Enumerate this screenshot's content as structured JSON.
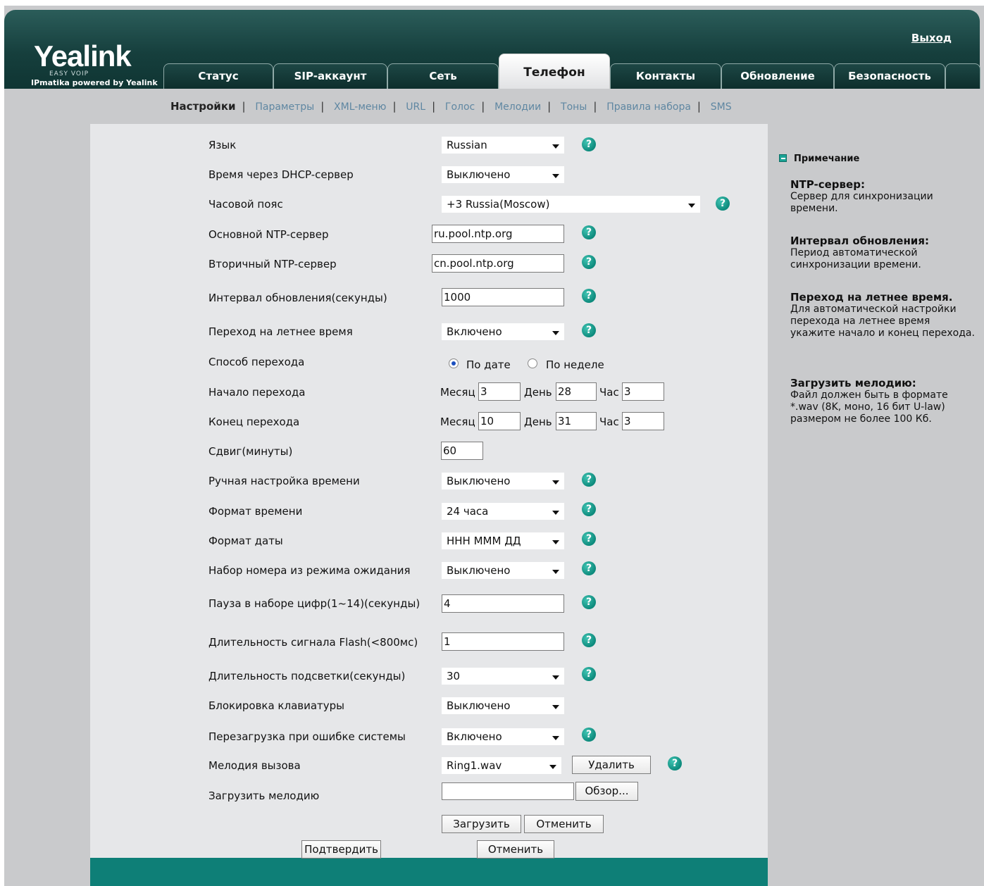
{
  "header": {
    "brand": "Yealink",
    "easy_voip": "EASY VOIP",
    "tagline": "IPmatika powered by Yealink",
    "logout": "Выход"
  },
  "tabs": [
    {
      "label": "Статус"
    },
    {
      "label": "SIP-аккаунт"
    },
    {
      "label": "Сеть"
    },
    {
      "label": "Телефон",
      "active": true
    },
    {
      "label": "Контакты"
    },
    {
      "label": "Обновление"
    },
    {
      "label": "Безопасность"
    }
  ],
  "subnav": [
    {
      "label": "Настройки",
      "active": true
    },
    {
      "label": "Параметры"
    },
    {
      "label": "XML-меню"
    },
    {
      "label": "URL"
    },
    {
      "label": "Голос"
    },
    {
      "label": "Мелодии"
    },
    {
      "label": "Тоны"
    },
    {
      "label": "Правила набора"
    },
    {
      "label": "SMS"
    }
  ],
  "form": {
    "language": {
      "label": "Язык",
      "value": "Russian"
    },
    "dhcp_time": {
      "label": "Время через DHCP-сервер",
      "value": "Выключено"
    },
    "timezone": {
      "label": "Часовой пояс",
      "value": "+3 Russia(Moscow)"
    },
    "ntp_primary": {
      "label": "Основной NTP-сервер",
      "value": "ru.pool.ntp.org"
    },
    "ntp_secondary": {
      "label": "Вторичный NTP-сервер",
      "value": "cn.pool.ntp.org"
    },
    "update_interval": {
      "label": "Интервал обновления(секунды)",
      "value": "1000"
    },
    "dst": {
      "label": "Переход на летнее время",
      "value": "Включено"
    },
    "dst_type": {
      "label": "Способ перехода",
      "option_date": "По дате",
      "option_week": "По неделе",
      "selected": "По дате"
    },
    "dst_start": {
      "label": "Начало перехода",
      "month_label": "Месяц",
      "month": "3",
      "day_label": "День",
      "day": "28",
      "hour_label": "Час",
      "hour": "3"
    },
    "dst_end": {
      "label": "Конец перехода",
      "month_label": "Месяц",
      "month": "10",
      "day_label": "День",
      "day": "31",
      "hour_label": "Час",
      "hour": "3"
    },
    "offset": {
      "label": "Сдвиг(минуты)",
      "value": "60"
    },
    "manual_time": {
      "label": "Ручная настройка времени",
      "value": "Выключено"
    },
    "time_format": {
      "label": "Формат времени",
      "value": "24 часа"
    },
    "date_format": {
      "label": "Формат даты",
      "value": "ННН МММ ДД"
    },
    "predial": {
      "label": "Набор номера из режима ожидания",
      "value": "Выключено"
    },
    "inter_digit": {
      "label": "Пауза в наборе цифр(1~14)(секунды)",
      "value": "4"
    },
    "flash_duration": {
      "label": "Длительность сигнала Flash(<800мс)",
      "value": "1"
    },
    "backlight": {
      "label": "Длительность подсветки(секунды)",
      "value": "30"
    },
    "keypad_lock": {
      "label": "Блокировка клавиатуры",
      "value": "Выключено"
    },
    "reboot_on_error": {
      "label": "Перезагрузка при ошибке системы",
      "value": "Включено"
    },
    "ringtone": {
      "label": "Мелодия вызова",
      "value": "Ring1.wav",
      "delete_label": "Удалить"
    },
    "upload_ring": {
      "label": "Загрузить мелодию",
      "value": "",
      "browse_label": "Обзор..."
    },
    "upload_button": "Загрузить",
    "upload_cancel": "Отменить",
    "confirm": "Подтвердить",
    "cancel": "Отменить"
  },
  "notes": {
    "heading": "Примечание",
    "items": [
      {
        "title": "NTP-сервер:",
        "text": "Сервер для синхронизации времени."
      },
      {
        "title": "Интервал обновления:",
        "text": "Период автоматической синхронизации времени."
      },
      {
        "title": "Переход на летнее время.",
        "text": "Для автоматической настройки перехода на летнее время укажите начало и конец перехода."
      },
      {
        "title": "Загрузить мелодию:",
        "text": "Файл должен быть в формате *.wav (8K, моно, 16 бит U-law) размером не более 100 Кб."
      }
    ]
  },
  "colors": {
    "header_dark": "#163f3d",
    "accent_teal": "#0e7f77",
    "background_gray": "#c9cacc",
    "content_bg": "#e6e7e9",
    "subnav_link": "#5f87a2"
  }
}
